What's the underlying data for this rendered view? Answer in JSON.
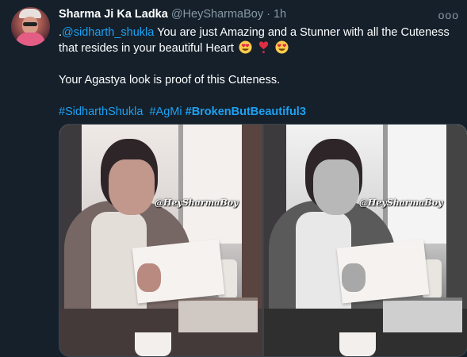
{
  "author": {
    "name": "Sharma Ji Ka Ladka",
    "handle": "@HeySharmaBoy",
    "separator": "·",
    "time": "1h"
  },
  "menu": {
    "more_label": "ooo"
  },
  "tweet": {
    "mention_prefix": ".",
    "mention": "@sidharth_shukla",
    "line1_text": " You are just Amazing and a Stunner with all the Cuteness that resides in your beautiful Heart",
    "emojis": [
      "heart-eyes-icon",
      "red-heart-exclamation-icon",
      "heart-eyes-icon"
    ],
    "paragraph2": "Your Agastya look is proof of this Cuteness.",
    "hashtags": [
      "#SidharthShukla",
      "#AgMi",
      "#BrokenButBeautiful3"
    ]
  },
  "media": {
    "photos": [
      {
        "style": "color",
        "watermark": "@HeySharmaBoy"
      },
      {
        "style": "black-and-white",
        "watermark": "@HeySharmaBoy"
      }
    ]
  },
  "colors": {
    "background": "#15202b",
    "text": "#ffffff",
    "muted": "#8899a6",
    "link": "#1da1f2"
  }
}
